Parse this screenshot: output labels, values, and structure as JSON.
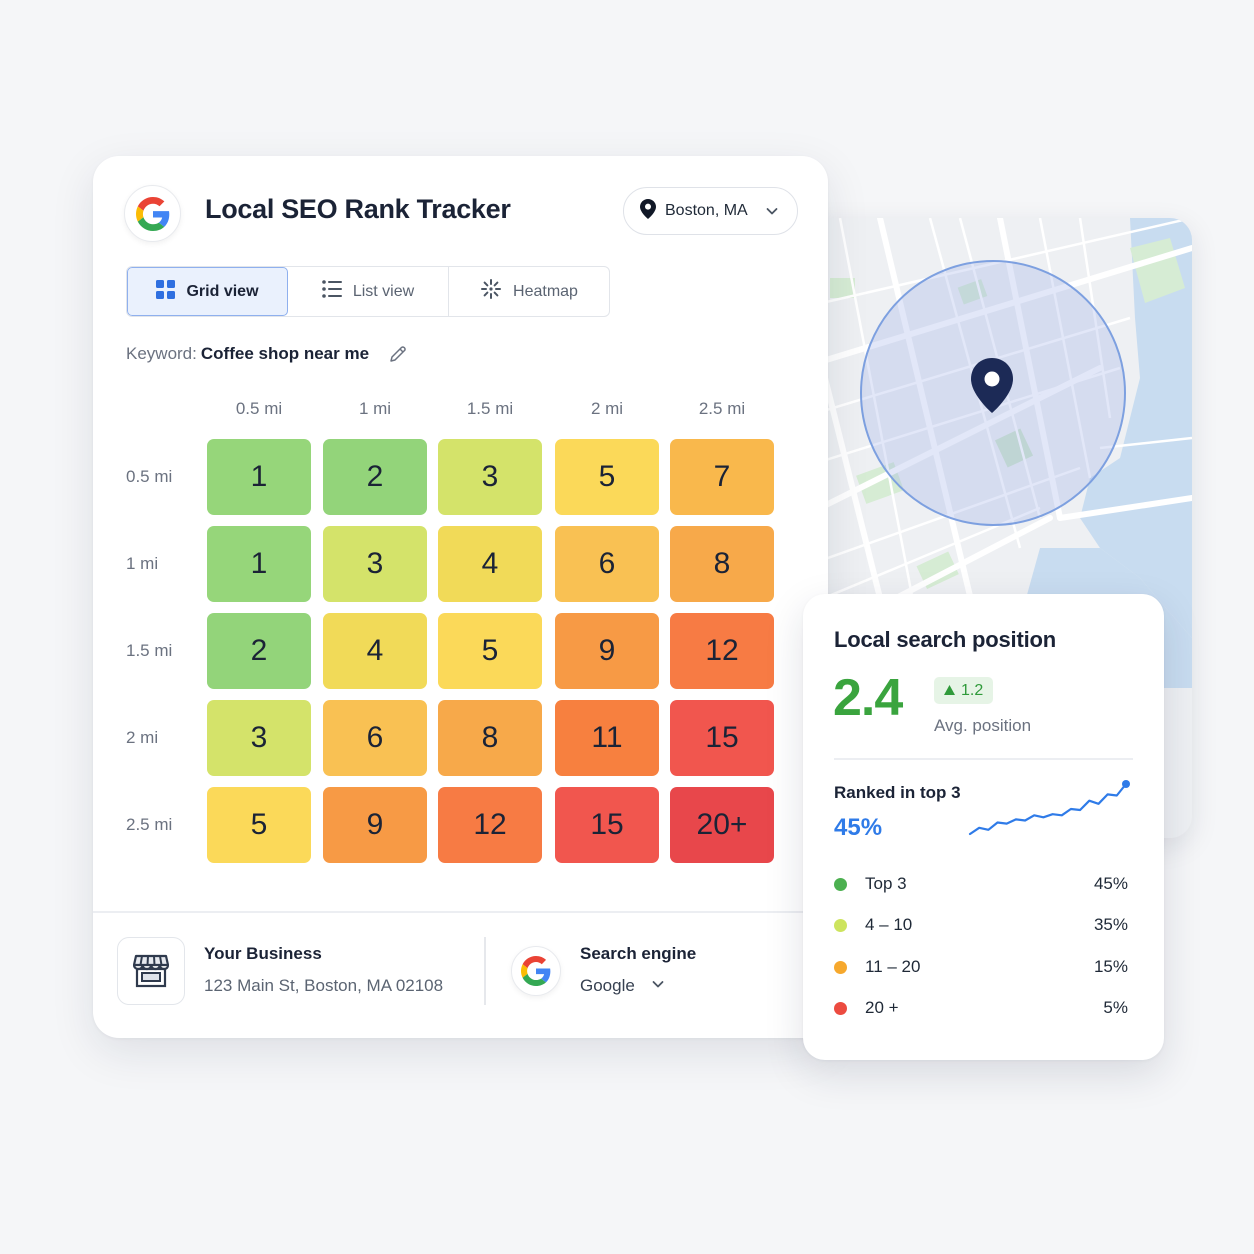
{
  "app": {
    "title": "Local SEO Rank Tracker",
    "logo_icon": "google-g-logo"
  },
  "location": {
    "value": "Boston, MA",
    "icon": "map-pin-icon"
  },
  "view_tabs": [
    {
      "label": "Grid view",
      "icon": "grid-icon",
      "active": true
    },
    {
      "label": "List view",
      "icon": "list-icon",
      "active": false
    },
    {
      "label": "Heatmap",
      "icon": "sparkle-icon",
      "active": false
    }
  ],
  "keyword": {
    "label": "Keyword:",
    "value": "Coffee shop near me"
  },
  "grid": {
    "columns": [
      "0.5 mi",
      "1 mi",
      "1.5 mi",
      "2 mi",
      "2.5 mi"
    ],
    "rows": [
      {
        "label": "0.5 mi",
        "cells": [
          "1",
          "2",
          "3",
          "5",
          "7"
        ]
      },
      {
        "label": "1 mi",
        "cells": [
          "1",
          "3",
          "4",
          "6",
          "8"
        ]
      },
      {
        "label": "1.5 mi",
        "cells": [
          "2",
          "4",
          "5",
          "9",
          "12"
        ]
      },
      {
        "label": "2 mi",
        "cells": [
          "3",
          "6",
          "8",
          "11",
          "15"
        ]
      },
      {
        "label": "2.5 mi",
        "cells": [
          "5",
          "9",
          "12",
          "15",
          "20+"
        ]
      }
    ],
    "colors": {
      "1": "#96d67a",
      "2": "#93d47a",
      "3": "#d4e36a",
      "4": "#f1da58",
      "5": "#fbd959",
      "6": "#f9c153",
      "7": "#f9b84c",
      "8": "#f7a94a",
      "9": "#f79a45",
      "11": "#f7803f",
      "12": "#f77b44",
      "15": "#f1564e",
      "20+": "#e8474b"
    }
  },
  "business": {
    "title": "Your Business",
    "address": "123 Main St, Boston, MA 02108",
    "icon": "storefront-icon"
  },
  "search_engine": {
    "title": "Search engine",
    "value": "Google",
    "icon": "google-g-logo"
  },
  "stats": {
    "title": "Local search position",
    "avg_position": "2.4",
    "delta": "1.2",
    "avg_label": "Avg. position",
    "top3_label": "Ranked in top 3",
    "top3_value": "45%",
    "distribution": [
      {
        "label": "Top 3",
        "pct": "45%",
        "color": "#4cb050"
      },
      {
        "label": "4 – 10",
        "pct": "35%",
        "color": "#cde45e"
      },
      {
        "label": "11 – 20",
        "pct": "15%",
        "color": "#f6a82d"
      },
      {
        "label": "20 +",
        "pct": "5%",
        "color": "#ec4b40"
      }
    ],
    "trend": [
      0,
      6,
      4,
      11,
      10,
      14,
      13,
      18,
      16,
      19,
      18,
      24,
      23,
      32,
      29,
      38,
      37,
      48
    ]
  },
  "colors": {
    "accent": "#2f7be8",
    "positive": "#3aa43e",
    "text": "#1b2336"
  }
}
